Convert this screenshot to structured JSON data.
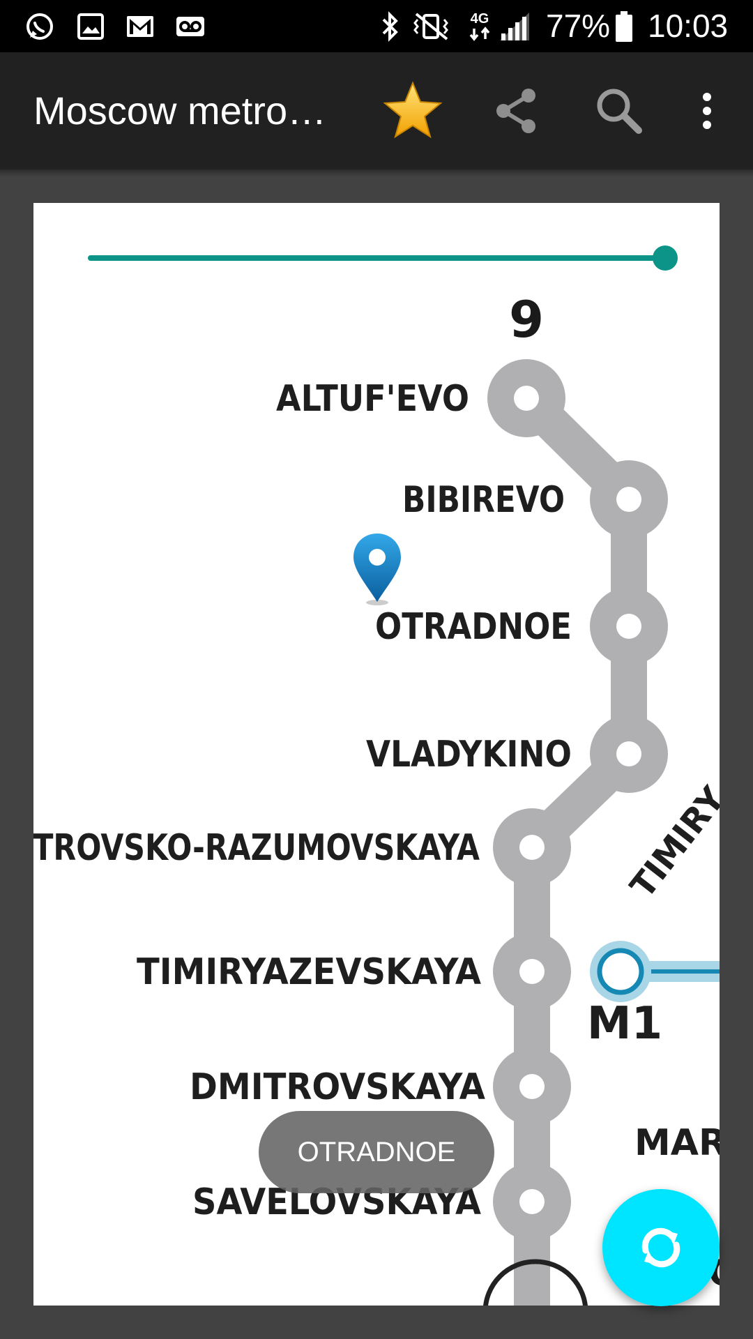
{
  "status_bar": {
    "battery": "77%",
    "time": "10:03",
    "network": "4G",
    "left_icons": [
      "whatsapp-icon",
      "gallery-icon",
      "gmail-icon",
      "voicemail-icon"
    ],
    "right_icons": [
      "bluetooth-icon",
      "vibrate-icon",
      "network-4g-icon",
      "signal-icon",
      "battery-icon"
    ]
  },
  "app_bar": {
    "title": "Moscow metro…",
    "actions": [
      "favorite-star-icon",
      "share-icon",
      "search-icon",
      "overflow-menu-icon"
    ]
  },
  "map": {
    "line_number": "9",
    "line_color": "#b0b0b2",
    "m1_color": "#1688b4",
    "stations": [
      "ALTUF'EVO",
      "BIBIREVO",
      "OTRADNOE",
      "VLADYKINO",
      "PETROVSKO-RAZUMOVSKAYA",
      "TIMIRYAZEVSKAYA",
      "DMITROVSKAYA",
      "SAVELOVSKAYA"
    ],
    "m1_label": "M1",
    "right_partial_timir": "TIMIRY",
    "right_partial_mar": "MAR",
    "right_partial_o": "O"
  },
  "slider": {
    "value": 1.0
  },
  "toast": "OTRADNOE",
  "fab": {
    "icon": "refresh-icon"
  },
  "accent": "#009688",
  "fab_color": "#00e5ff"
}
